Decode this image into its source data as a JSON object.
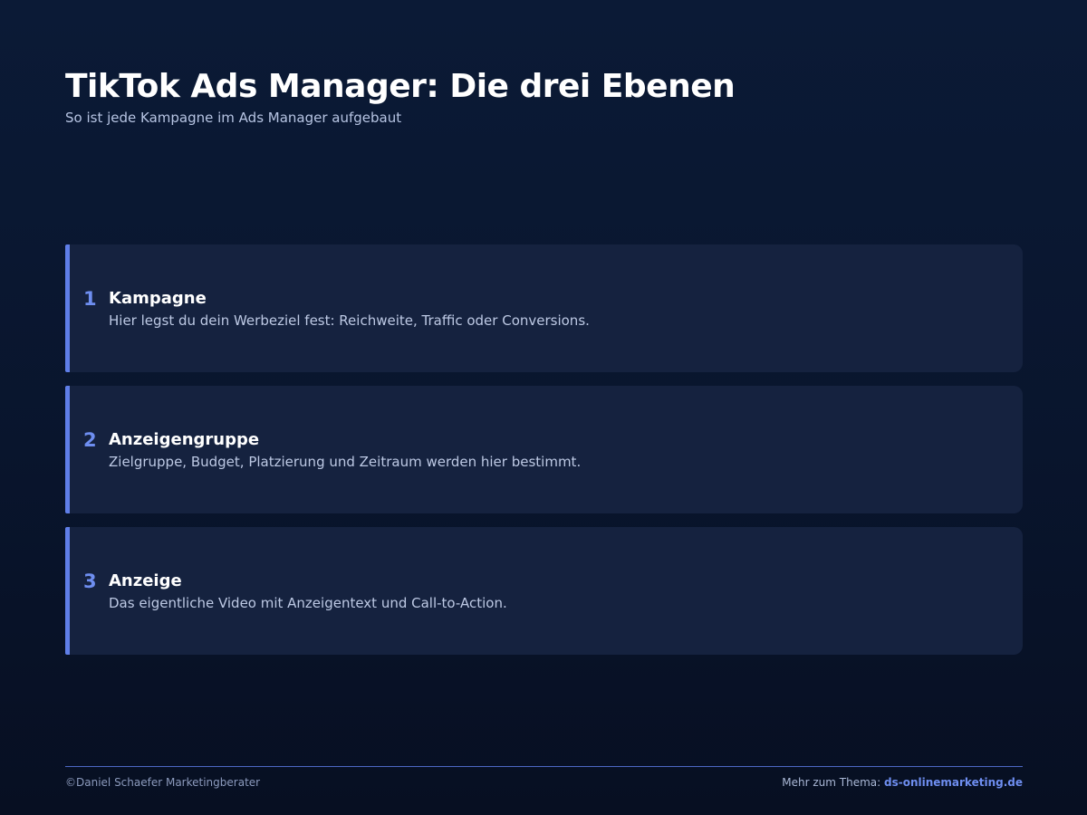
{
  "header": {
    "title": "TikTok Ads Manager: Die drei Ebenen",
    "subtitle": "So ist jede Kampagne im Ads Manager aufgebaut"
  },
  "levels": [
    {
      "number": "1",
      "name": "Kampagne",
      "description": "Hier legst du dein Werbeziel fest: Reichweite, Traffic oder Conversions."
    },
    {
      "number": "2",
      "name": "Anzeigengruppe",
      "description": "Zielgruppe, Budget, Platzierung und Zeitraum werden hier bestimmt."
    },
    {
      "number": "3",
      "name": "Anzeige",
      "description": "Das eigentliche Video mit Anzeigentext und Call-to-Action."
    }
  ],
  "footer": {
    "copyright": "©Daniel Schaefer Marketingberater",
    "more_label": "Mehr zum Thema:",
    "link_text": "ds-onlinemarketing.de"
  },
  "colors": {
    "background": "#0b1a36",
    "card": "#15223f",
    "accent": "#5f7ee8",
    "text": "#ffffff"
  }
}
